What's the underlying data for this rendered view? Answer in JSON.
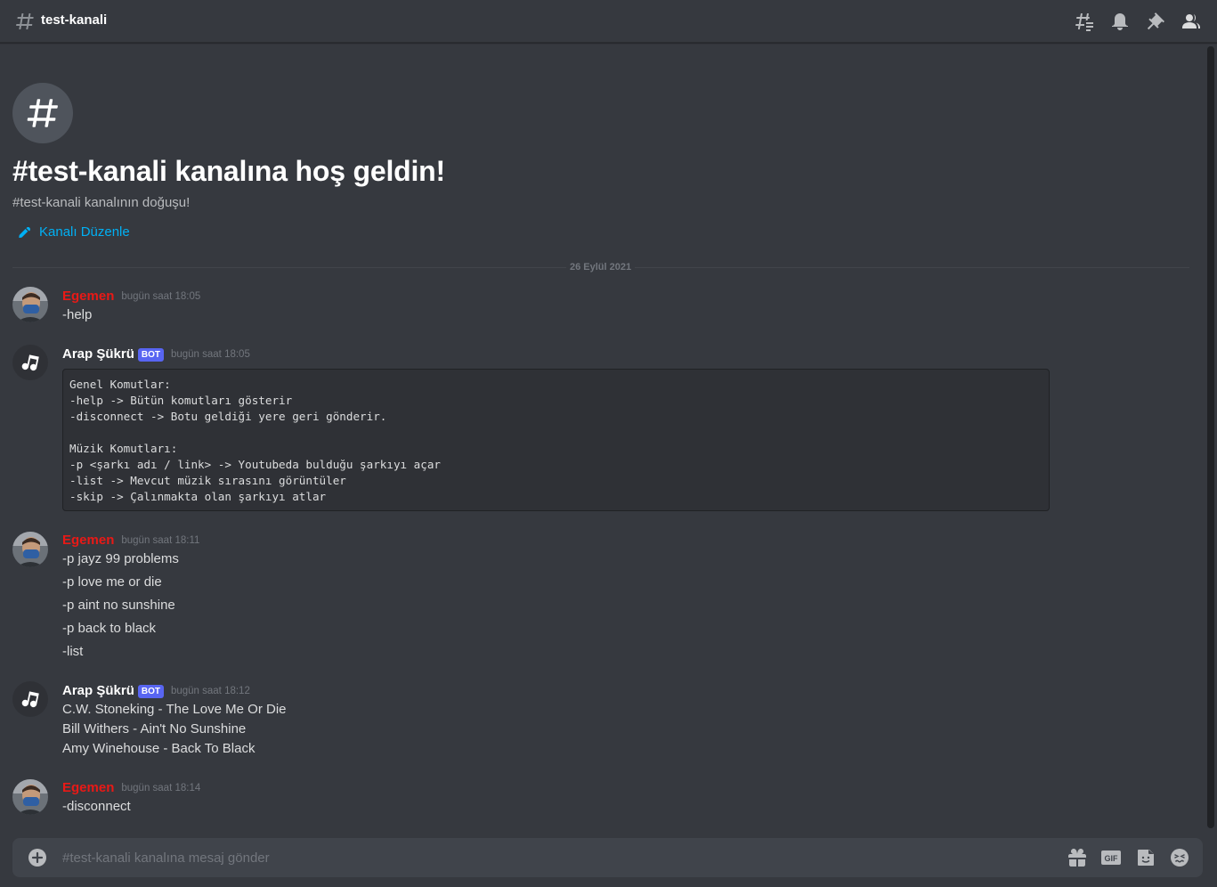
{
  "header": {
    "channel_name": "test-kanali",
    "icons": [
      "threads-icon",
      "bell-icon",
      "pin-icon",
      "members-icon"
    ]
  },
  "welcome": {
    "title": "#test-kanali kanalına hoş geldin!",
    "subtitle": "#test-kanali kanalının doğuşu!",
    "edit_label": "Kanalı Düzenle"
  },
  "date_divider": "26 Eylül 2021",
  "messages": [
    {
      "author": "Egemen",
      "timestamp": "bugün saat 18:05",
      "lines": [
        "-help"
      ]
    },
    {
      "author": "Arap Şükrü",
      "bot_tag": "BOT",
      "timestamp": "bugün saat 18:05",
      "code": "Genel Komutlar:\n-help -> Bütün komutları gösterir\n-disconnect -> Botu geldiği yere geri gönderir.\n\nMüzik Komutları:\n-p <şarkı adı / link> -> Youtubeda bulduğu şarkıyı açar\n-list -> Mevcut müzik sırasını görüntüler\n-skip -> Çalınmakta olan şarkıyı atlar"
    },
    {
      "author": "Egemen",
      "timestamp": "bugün saat 18:11",
      "lines": [
        "-p jayz 99 problems",
        "-p love me or die",
        "-p aint no sunshine",
        "-p back to black",
        "-list"
      ]
    },
    {
      "author": "Arap Şükrü",
      "bot_tag": "BOT",
      "timestamp": "bugün saat 18:12",
      "lines": [
        "C.W. Stoneking - The Love Me Or Die",
        "Bill Withers - Ain't No Sunshine",
        "Amy Winehouse - Back To Black"
      ]
    },
    {
      "author": "Egemen",
      "timestamp": "bugün saat 18:14",
      "lines": [
        "-disconnect"
      ]
    }
  ],
  "composer": {
    "placeholder": "#test-kanali kanalına mesaj gönder",
    "value": "",
    "icons": [
      "gift-icon",
      "gif-icon",
      "sticker-icon",
      "emoji-icon"
    ]
  },
  "colors": {
    "background": "#36393f",
    "user_name": "#e91916",
    "link": "#00b0f4",
    "bot_tag": "#5865f2",
    "composer": "#40444b"
  }
}
